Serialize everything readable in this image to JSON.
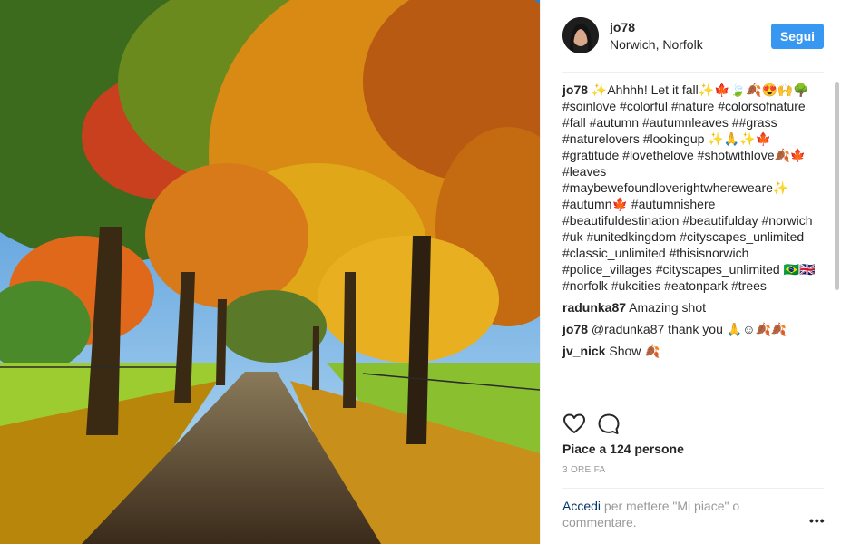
{
  "header": {
    "username": "jo78",
    "location": "Norwich, Norfolk",
    "follow_label": "Segui"
  },
  "caption": {
    "username": "jo78",
    "text": " ✨Ahhhh! Let it fall✨🍁🍃🍂😍🙌🌳 #soinlove #colorful #nature #colorsofnature #fall #autumn #autumnleaves ##grass #naturelovers #lookingup ✨🙏✨🍁 #gratitude #lovethelove #shotwithlove🍂🍁 #leaves #maybewefoundloverightwhereweare✨ #autumn🍁 #autumnishere #beautifuldestination #beautifulday #norwich #uk #unitedkingdom #cityscapes_unlimited #classic_unlimited #thisisnorwich #police_villages #cityscapes_unlimited 🇧🇷🇬🇧 #norfolk #ukcities #eatonpark #trees"
  },
  "comments": [
    {
      "username": "radunka87",
      "text": "Amazing shot"
    },
    {
      "username": "jo78",
      "text": "@radunka87 thank you 🙏☺🍂🍂"
    },
    {
      "username": "jv_nick",
      "text": "Show 🍂"
    },
    {
      "username": "",
      "text": ""
    }
  ],
  "actions": {
    "like_icon": "heart-icon",
    "comment_icon": "comment-icon"
  },
  "likes": "Piace a 124 persone",
  "timestamp": "3 ORE FA",
  "login": {
    "link_label": "Accedi",
    "rest": " per mettere \"Mi piace\" o commentare."
  },
  "more_label": "•••",
  "colors": {
    "follow_button": "#3897f0",
    "link": "#003569",
    "muted": "#999999"
  }
}
